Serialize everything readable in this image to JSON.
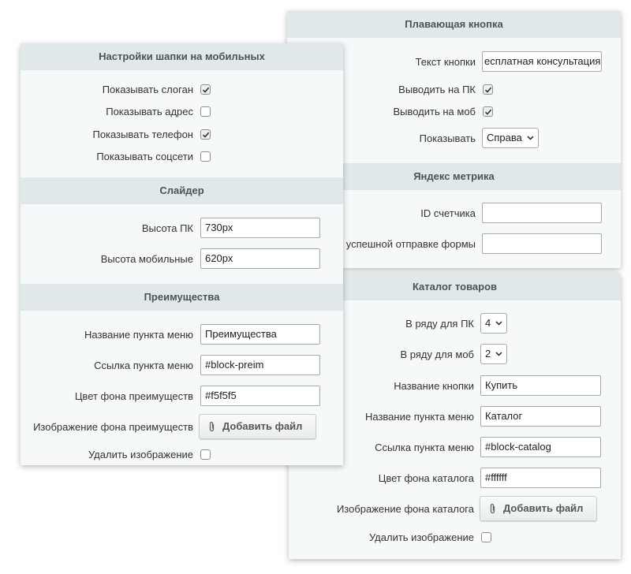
{
  "left_panel": {
    "header_settings": {
      "title": "Настройки шапки на мобильных",
      "show_slogan": {
        "label": "Показывать слоган",
        "checked": true
      },
      "show_address": {
        "label": "Показывать адрес",
        "checked": false
      },
      "show_phone": {
        "label": "Показывать телефон",
        "checked": true
      },
      "show_social": {
        "label": "Показывать соцсети",
        "checked": false
      }
    },
    "slider": {
      "title": "Слайдер",
      "height_pc": {
        "label": "Высота ПК",
        "value": "730px"
      },
      "height_mobile": {
        "label": "Высота мобильные",
        "value": "620px"
      }
    },
    "advantages": {
      "title": "Преимущества",
      "menu_name": {
        "label": "Название пункта меню",
        "value": "Преимущества"
      },
      "menu_link": {
        "label": "Ссылка пункта меню",
        "value": "#block-preim"
      },
      "bg_color": {
        "label": "Цвет фона преимуществ",
        "value": "#f5f5f5"
      },
      "bg_image": {
        "label": "Изображение фона преимуществ",
        "button": "Добавить файл"
      },
      "delete_image": {
        "label": "Удалить изображение",
        "checked": false
      }
    }
  },
  "right_panel": {
    "floating_button": {
      "title": "Плавающая кнопка",
      "button_text": {
        "label": "Текст кнопки",
        "value": "есплатная консультация"
      },
      "show_pc": {
        "label": "Выводить на ПК",
        "checked": true
      },
      "show_mobile": {
        "label": "Выводить на моб",
        "checked": true
      },
      "position": {
        "label": "Показывать",
        "value": "Справа"
      }
    },
    "yandex_metrika": {
      "title": "Яндекс метрика",
      "counter_id": {
        "label": "ID счетчика",
        "value": ""
      },
      "on_form_submit": {
        "label": "и успешной отправке формы",
        "value": ""
      }
    },
    "catalog": {
      "title": "Каталог товаров",
      "row_pc": {
        "label": "В ряду для ПК",
        "value": "4"
      },
      "row_mobile": {
        "label": "В ряду для моб",
        "value": "2"
      },
      "button_name": {
        "label": "Название кнопки",
        "value": "Купить"
      },
      "menu_name": {
        "label": "Название пункта меню",
        "value": "Каталог"
      },
      "menu_link": {
        "label": "Ссылка пункта меню",
        "value": "#block-catalog"
      },
      "bg_color": {
        "label": "Цвет фона каталога",
        "value": "#ffffff"
      },
      "bg_image": {
        "label": "Изображение фона каталога",
        "button": "Добавить файл"
      },
      "delete_image": {
        "label": "Удалить изображение",
        "checked": false
      }
    }
  },
  "icons": {
    "checkmark": "check-icon",
    "paperclip": "paperclip-icon",
    "dropdown": "chevron-down-icon"
  },
  "colors": {
    "panel_bg": "#f5f9f9",
    "section_header_bg": "#e1e8e9",
    "header_text": "#4b5455"
  }
}
